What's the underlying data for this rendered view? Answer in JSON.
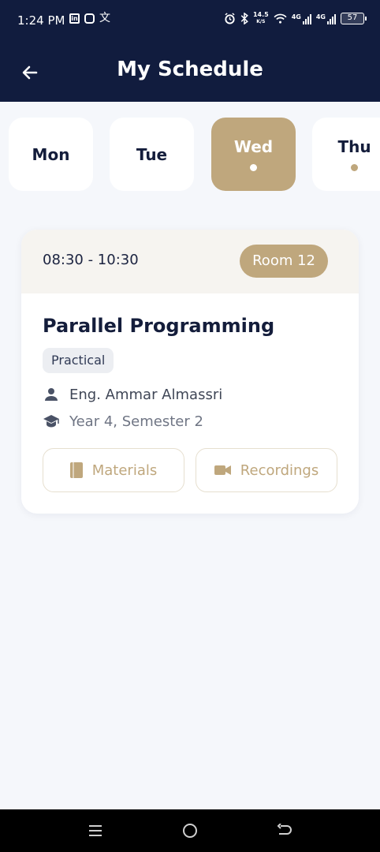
{
  "status_bar": {
    "time": "1:24 PM",
    "net_speed_value": "14.5",
    "net_speed_unit": "K/S",
    "network_1": "4G",
    "network_2": "4G",
    "battery": "57"
  },
  "header": {
    "title": "My Schedule"
  },
  "days": [
    {
      "label": "Mon",
      "active": false,
      "has_classes": false
    },
    {
      "label": "Tue",
      "active": false,
      "has_classes": false
    },
    {
      "label": "Wed",
      "active": true,
      "has_classes": true
    },
    {
      "label": "Thu",
      "active": false,
      "has_classes": true
    }
  ],
  "class_card": {
    "time_range": "08:30 - 10:30",
    "room": "Room 12",
    "course": "Parallel Programming",
    "type": "Practical",
    "instructor": "Eng. Ammar Almassri",
    "semester": "Year 4, Semester 2",
    "materials_label": "Materials",
    "recordings_label": "Recordings"
  },
  "colors": {
    "header_bg": "#111c3e",
    "accent": "#bfa77d",
    "page_bg": "#f5f7fb",
    "text_dark": "#141d3b"
  },
  "icons": {
    "back": "arrow-left-icon",
    "instructor": "person-icon",
    "semester": "graduation-cap-icon",
    "materials": "book-icon",
    "recordings": "video-camera-icon"
  }
}
